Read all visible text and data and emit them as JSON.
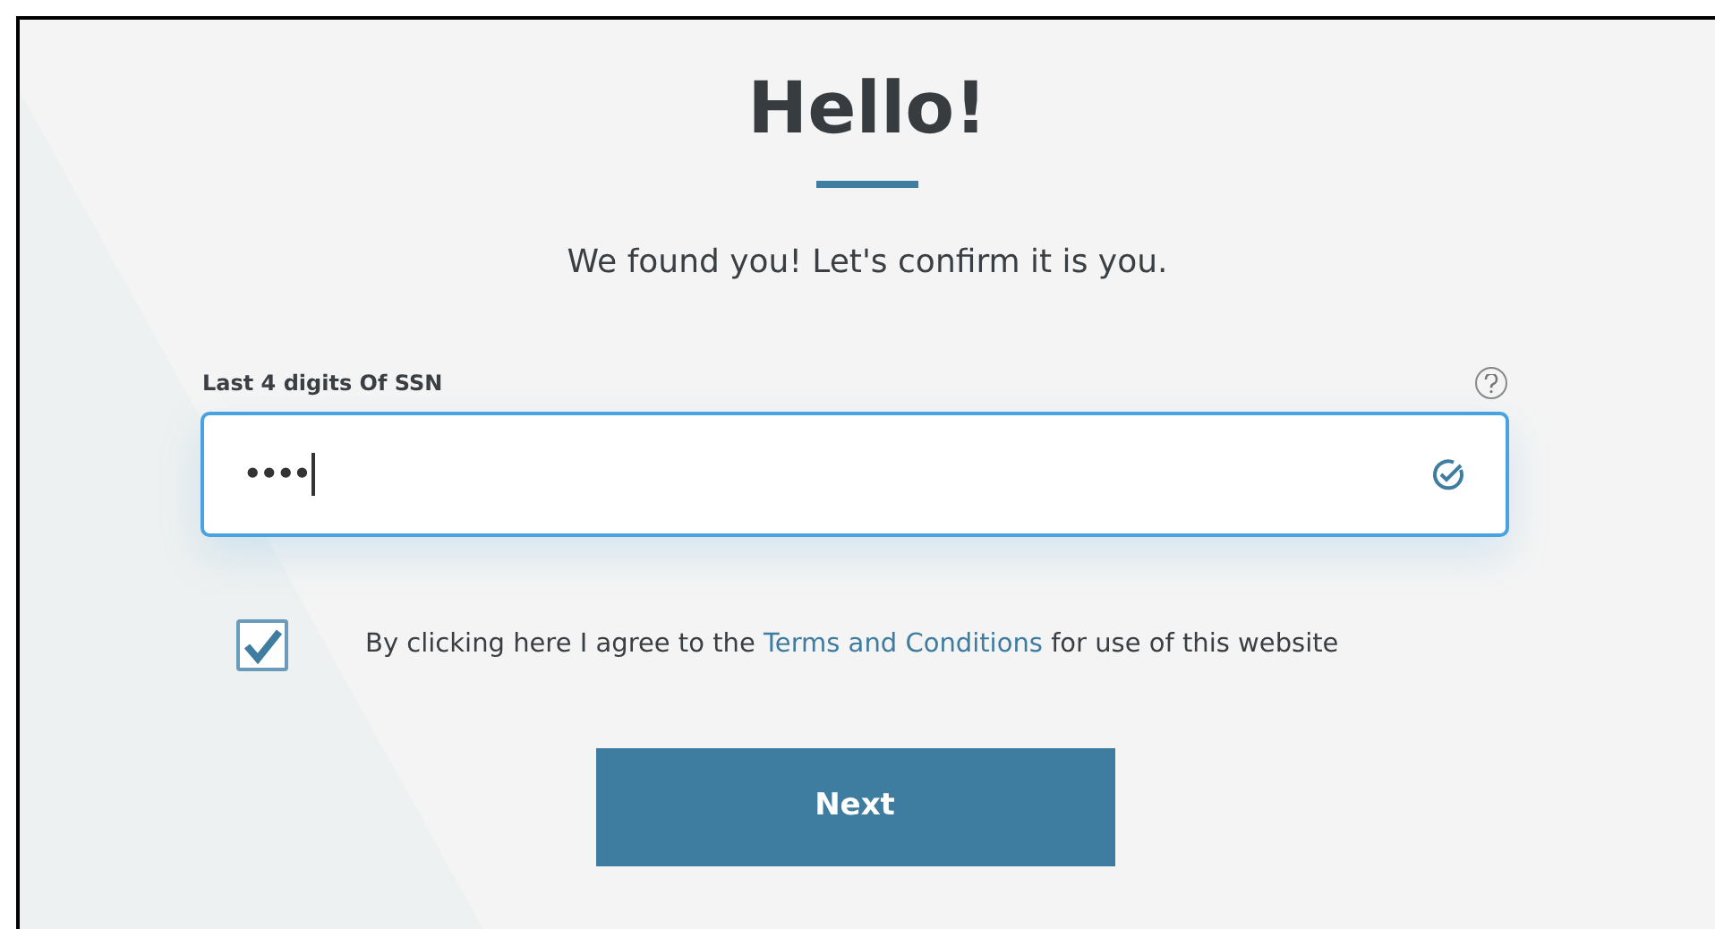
{
  "title": "Hello!",
  "subtitle": "We found you! Let's confirm it is you.",
  "ssn_field": {
    "label": "Last 4 digits Of SSN",
    "value": "••••",
    "valid": true
  },
  "agreement": {
    "checked": true,
    "text_before": "By clicking here I agree to the",
    "link": "Terms and Conditions",
    "text_after": "for use of this website"
  },
  "next_button": {
    "label": "Next"
  }
}
